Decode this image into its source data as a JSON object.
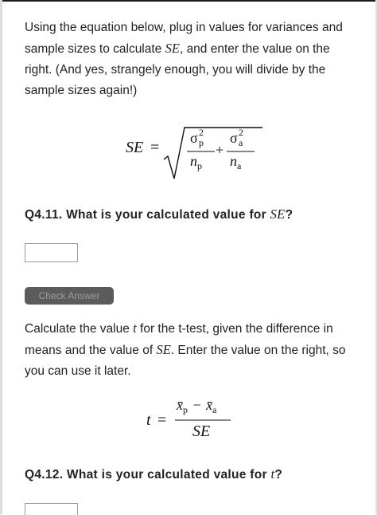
{
  "intro": {
    "text_before": "Using the equation below, plug in values for variances and sample sizes to calculate ",
    "se": "SE",
    "text_after": ", and enter the value on the right. (And yes, strangely enough, you will divide by the sample sizes again!)"
  },
  "se_formula": {
    "lhs": "SE",
    "equals": "=",
    "sigma": "σ",
    "exp": "2",
    "sub_p": "p",
    "sub_a": "a",
    "n": "n",
    "plus": "+"
  },
  "q411": {
    "label_before": "Q4.11. What is your calculated value for ",
    "var": "SE",
    "label_after": "?",
    "input_value": ""
  },
  "check_answer_label": "Check Answer",
  "t_intro": {
    "text_1": "Calculate the value ",
    "t": "t",
    "text_2": " for the t-test, given the difference in means and the value of ",
    "se": "SE",
    "text_3": ". Enter the value on the right, so you can use it later."
  },
  "t_formula": {
    "lhs": "t",
    "equals": "=",
    "xbar": "x̄",
    "minus": "−",
    "sub_p": "p",
    "sub_a": "a",
    "denominator": "SE"
  },
  "q412": {
    "label_before": "Q4.12. What is your calculated value for ",
    "var": "t",
    "label_after": "?",
    "input_value": ""
  }
}
